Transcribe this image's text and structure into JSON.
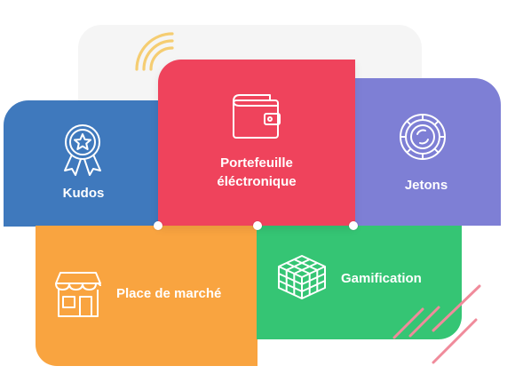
{
  "tiles": {
    "kudos": {
      "label": "Kudos",
      "icon": "award-badge-icon",
      "color": "#3f79bd"
    },
    "wallet": {
      "label_line1": "Portefeuille",
      "label_line2": "éléctronique",
      "icon": "wallet-icon",
      "color": "#ef435c"
    },
    "jetons": {
      "label": "Jetons",
      "icon": "token-coin-icon",
      "color": "#7e7fd5"
    },
    "place": {
      "label": "Place de marché",
      "icon": "store-icon",
      "color": "#f9a440"
    },
    "gamification": {
      "label": "Gamification",
      "icon": "cube-icon",
      "color": "#35c574"
    }
  },
  "decorations": {
    "wifi": {
      "icon": "wifi-signal-icon",
      "color": "#f5cd72"
    },
    "stripes": {
      "color": "#f08b9b"
    }
  }
}
